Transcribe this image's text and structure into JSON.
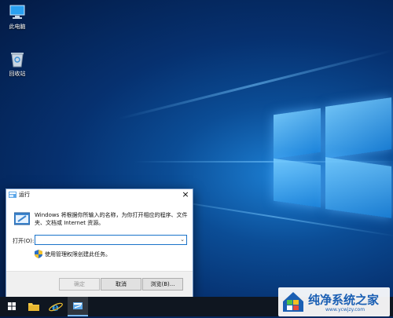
{
  "desktop": {
    "icons": [
      {
        "label": "此电脑",
        "icon": "computer-icon"
      },
      {
        "label": "回收站",
        "icon": "recycle-bin-icon"
      }
    ]
  },
  "run_dialog": {
    "title": "运行",
    "description": "Windows 将根据你所输入的名称，为你打开相应的程序、文件夹、文档或 Internet 资源。",
    "open_label": "打开(O):",
    "open_value": "",
    "admin_note": "使用管理权限创建此任务。",
    "buttons": {
      "ok": "确定",
      "cancel": "取消",
      "browse": "浏览(B)..."
    }
  },
  "taskbar": {
    "items": [
      "windows-start-icon",
      "file-explorer-icon",
      "internet-explorer-icon",
      "run-app-icon"
    ]
  },
  "watermark": {
    "title": "纯净系统之家",
    "url": "www.ycwjzy.com"
  },
  "colors": {
    "accent": "#1a73c9",
    "taskbar": "#0f1620",
    "wallpaper": "#0b4d96"
  }
}
